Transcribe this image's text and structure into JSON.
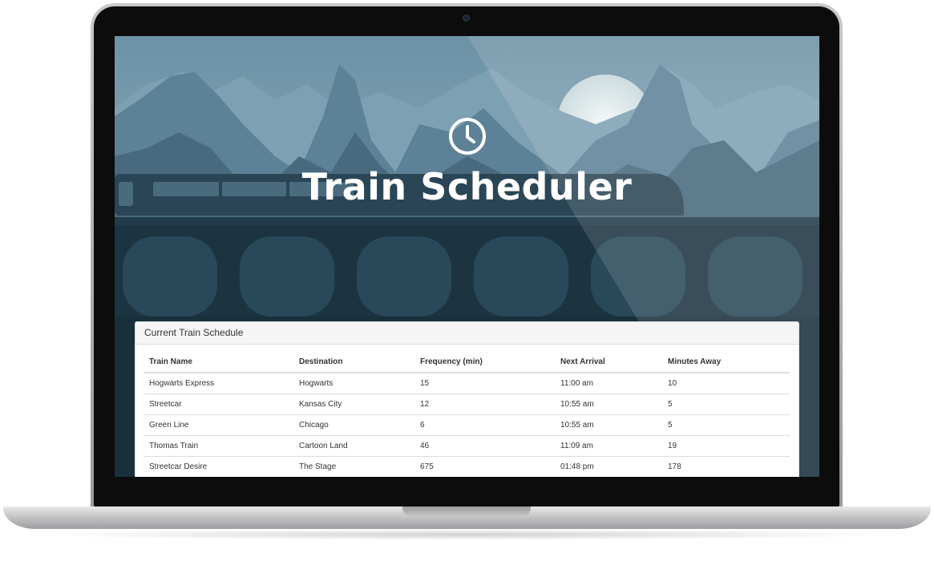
{
  "app": {
    "title": "Train Scheduler",
    "icon": "clock-icon"
  },
  "panel": {
    "heading": "Current Train Schedule",
    "columns": [
      "Train Name",
      "Destination",
      "Frequency (min)",
      "Next Arrival",
      "Minutes Away"
    ],
    "rows": [
      [
        "Hogwarts Express",
        "Hogwarts",
        "15",
        "11:00 am",
        "10"
      ],
      [
        "Streetcar",
        "Kansas City",
        "12",
        "10:55 am",
        "5"
      ],
      [
        "Green Line",
        "Chicago",
        "6",
        "10:55 am",
        "5"
      ],
      [
        "Thomas Train",
        "Cartoon Land",
        "46",
        "11:09 am",
        "19"
      ],
      [
        "Streetcar Desire",
        "The Stage",
        "675",
        "01:48 pm",
        "178"
      ]
    ]
  },
  "colors": {
    "sky": "#9fb8c3",
    "mountain_far": "#5e8299",
    "mountain_near": "#3e5f73",
    "ground": "#1c3442",
    "title_text": "#ffffff"
  }
}
